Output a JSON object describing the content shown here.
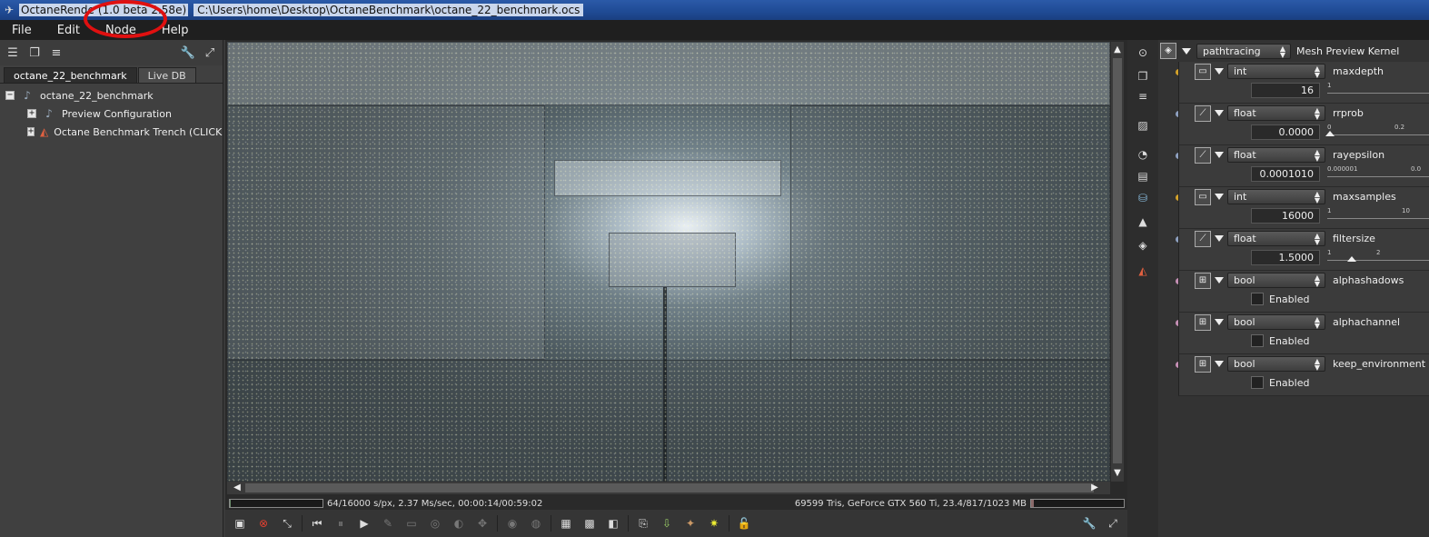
{
  "title_bar": {
    "app_name": "OctaneRende",
    "version": "(1.0 beta 2.58e)",
    "path": "C:\\Users\\home\\Desktop\\OctaneBenchmark\\octane_22_benchmark.ocs"
  },
  "menu": [
    "File",
    "Edit",
    "Node",
    "Help"
  ],
  "left_panel": {
    "tabs": [
      "octane_22_benchmark",
      "Live DB"
    ],
    "tree": {
      "root": "octane_22_benchmark",
      "children": [
        "Preview Configuration",
        "Octane Benchmark Trench (CLICK MI"
      ]
    }
  },
  "status": {
    "left": "64/16000 s/px, 2.37 Ms/sec, 00:00:14/00:59:02",
    "right": "69599 Tris, GeForce GTX 560 Ti, 23.4/817/1023 MB",
    "progress_fraction": 0.004,
    "memory_fraction": 0.03
  },
  "kernel": {
    "dropdown": "pathtracing",
    "title": "Mesh Preview Kernel"
  },
  "params": [
    {
      "type": "int",
      "name": "maxdepth",
      "value": "16",
      "tick_left": "1",
      "tick_mid": "",
      "pin_color": "#d4a22a"
    },
    {
      "type": "float",
      "name": "rrprob",
      "value": "0.0000",
      "tick_left": "0",
      "tick_mid": "0.2",
      "pin_color": "#8ea0c0"
    },
    {
      "type": "float",
      "name": "rayepsilon",
      "value": "0.0001010",
      "tick_left": "0.000001",
      "tick_mid": "0.0",
      "pin_color": "#8ea0c0"
    },
    {
      "type": "int",
      "name": "maxsamples",
      "value": "16000",
      "tick_left": "1",
      "tick_mid": "10",
      "pin_color": "#d4a22a"
    },
    {
      "type": "float",
      "name": "filtersize",
      "value": "1.5000",
      "tick_left": "1",
      "tick_mid": "2",
      "pin_color": "#8ea0c0"
    },
    {
      "type": "bool",
      "name": "alphashadows",
      "check_label": "Enabled",
      "pin_color": "#c58fb5"
    },
    {
      "type": "bool",
      "name": "alphachannel",
      "check_label": "Enabled",
      "pin_color": "#c58fb5"
    },
    {
      "type": "bool",
      "name": "keep_environment",
      "check_label": "Enabled",
      "pin_color": "#c58fb5"
    }
  ]
}
